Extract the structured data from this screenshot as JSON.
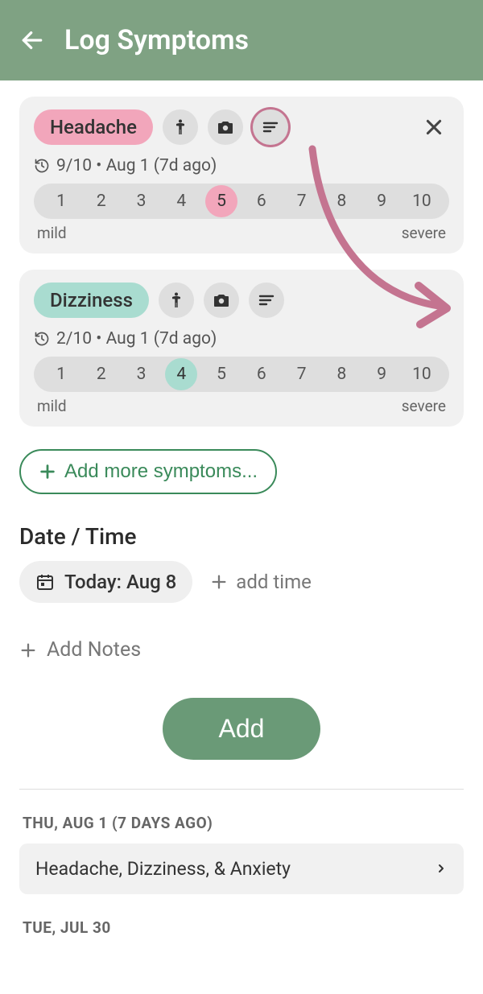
{
  "header": {
    "title": "Log Symptoms"
  },
  "cards": [
    {
      "name": "Headache",
      "pill_class": "pill-pink",
      "history": "9/10 • Aug 1 (7d ago)",
      "selected": 5,
      "sel_class": "sel-pink",
      "notes_highlighted": true,
      "show_close": true
    },
    {
      "name": "Dizziness",
      "pill_class": "pill-teal",
      "history": "2/10 • Aug 1 (7d ago)",
      "selected": 4,
      "sel_class": "sel-teal",
      "notes_highlighted": false,
      "show_close": false
    }
  ],
  "scale_labels": {
    "low": "mild",
    "high": "severe"
  },
  "add_more": "Add more symptoms...",
  "datetime": {
    "section": "Date / Time",
    "today_chip": "Today: Aug 8",
    "add_time": "add time"
  },
  "add_notes": "Add Notes",
  "primary": "Add",
  "history_section": [
    {
      "date": "THU, AUG 1 (7 DAYS AGO)",
      "entry": "Headache, Dizziness, & Anxiety"
    },
    {
      "date": "TUE, JUL 30"
    }
  ]
}
